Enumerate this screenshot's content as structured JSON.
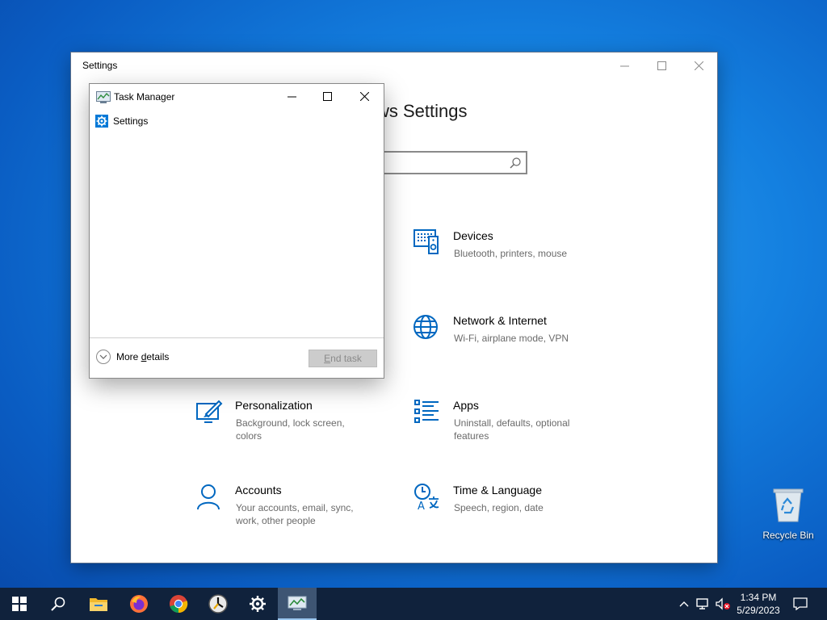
{
  "settings": {
    "window_title": "Settings",
    "heading": "ws Settings",
    "categories": [
      {
        "title": "Devices",
        "desc": "Bluetooth, printers, mouse",
        "icon": "devices-icon"
      },
      {
        "title": "Network & Internet",
        "desc": "Wi-Fi, airplane mode, VPN",
        "icon": "globe-icon"
      },
      {
        "title": "Personalization",
        "desc": "Background, lock screen, colors",
        "icon": "personalization-icon"
      },
      {
        "title": "Apps",
        "desc": "Uninstall, defaults, optional features",
        "icon": "apps-icon"
      },
      {
        "title": "Accounts",
        "desc": "Your accounts, email, sync, work, other people",
        "icon": "person-icon"
      },
      {
        "title": "Time & Language",
        "desc": "Speech, region, date",
        "icon": "time-language-icon"
      }
    ]
  },
  "task_manager": {
    "title": "Task Manager",
    "apps": [
      {
        "name": "Settings",
        "icon": "gear-icon"
      }
    ],
    "more_details_prefix": "More ",
    "more_details_accel": "d",
    "more_details_suffix": "etails",
    "end_task_accel": "E",
    "end_task_rest": "nd task"
  },
  "desktop": {
    "recycle_bin_label": "Recycle Bin"
  },
  "taskbar": {
    "time": "1:34 PM",
    "date": "5/29/2023",
    "apps": [
      "start-icon",
      "search-icon",
      "file-explorer-icon",
      "firefox-icon",
      "chrome-icon",
      "clock-app-icon",
      "settings-gear-icon",
      "task-manager-icon"
    ]
  },
  "colors": {
    "accent": "#0067c0",
    "taskbar": "#10223c",
    "desktop": "#1480e0"
  }
}
